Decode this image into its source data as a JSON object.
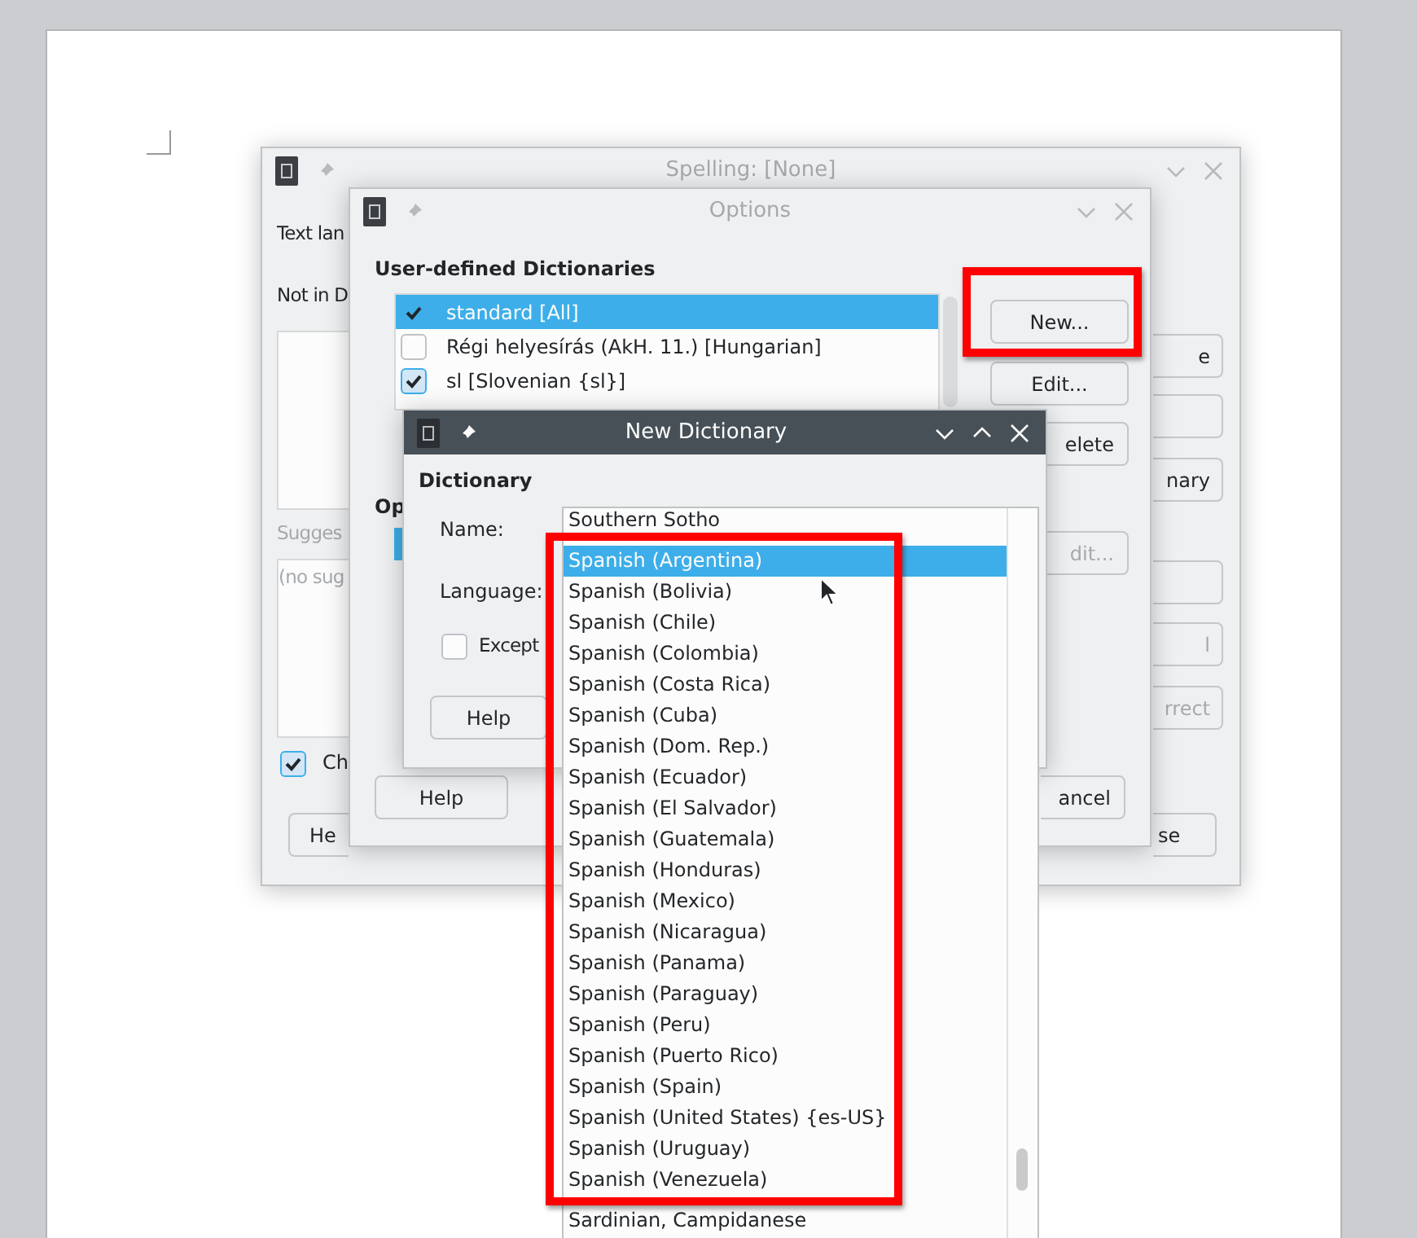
{
  "spelling_window": {
    "title": "Spelling: [None]",
    "text_language_label": "Text lan",
    "not_in_dictionary_label": "Not in D",
    "suggestions_label": "Sugges",
    "suggestions_placeholder": "(no sug",
    "check_option": {
      "label": "Ch",
      "checked": true
    },
    "buttons": [
      {
        "label": "e",
        "disabled": false
      },
      {
        "label": "nary",
        "disabled": false
      },
      {
        "label": "l",
        "disabled": true
      },
      {
        "label": "rrect",
        "disabled": true
      }
    ],
    "help_button": "He",
    "close_button": "se"
  },
  "options_window": {
    "title": "Options",
    "dictionaries_heading": "User-defined Dictionaries",
    "dictionaries": [
      {
        "name": "standard [All]",
        "checked": true,
        "selected": true
      },
      {
        "name": "Régi helyesírás (AkH. 11.) [Hungarian]",
        "checked": false,
        "selected": false
      },
      {
        "name": "sl [Slovenian {sl}]",
        "checked": true,
        "selected": false
      }
    ],
    "buttons": [
      {
        "label": "New...",
        "disabled": false
      },
      {
        "label": "Edit...",
        "disabled": false
      },
      {
        "label": "elete",
        "disabled": false
      },
      {
        "label": "dit...",
        "disabled": true
      }
    ],
    "options_heading": "Op",
    "help_button": "Help",
    "cancel_button": "ancel"
  },
  "new_dictionary_window": {
    "title": "New Dictionary",
    "section_heading": "Dictionary",
    "name_label": "Name:",
    "language_label": "Language:",
    "exceptions": {
      "label": "Except",
      "checked": false
    },
    "help_button": "Help"
  },
  "language_dropdown": {
    "items": [
      {
        "label": "Southern Sotho",
        "selected": false
      },
      {
        "label": "Spanish (Argentina)",
        "selected": true
      },
      {
        "label": "Spanish (Bolivia)",
        "selected": false
      },
      {
        "label": "Spanish (Chile)",
        "selected": false
      },
      {
        "label": "Spanish (Colombia)",
        "selected": false
      },
      {
        "label": "Spanish (Costa Rica)",
        "selected": false
      },
      {
        "label": "Spanish (Cuba)",
        "selected": false
      },
      {
        "label": "Spanish (Dom. Rep.)",
        "selected": false
      },
      {
        "label": "Spanish (Ecuador)",
        "selected": false
      },
      {
        "label": "Spanish (El Salvador)",
        "selected": false
      },
      {
        "label": "Spanish (Guatemala)",
        "selected": false
      },
      {
        "label": "Spanish (Honduras)",
        "selected": false
      },
      {
        "label": "Spanish (Mexico)",
        "selected": false
      },
      {
        "label": "Spanish (Nicaragua)",
        "selected": false
      },
      {
        "label": "Spanish (Panama)",
        "selected": false
      },
      {
        "label": "Spanish (Paraguay)",
        "selected": false
      },
      {
        "label": "Spanish (Peru)",
        "selected": false
      },
      {
        "label": "Spanish (Puerto Rico)",
        "selected": false
      },
      {
        "label": "Spanish (Spain)",
        "selected": false
      },
      {
        "label": "Spanish (United States) {es-US}",
        "selected": false
      },
      {
        "label": "Spanish (Uruguay)",
        "selected": false
      },
      {
        "label": "Spanish (Venezuela)",
        "selected": false
      },
      {
        "label": "Sardinian, Campidanese",
        "selected": false
      }
    ]
  }
}
